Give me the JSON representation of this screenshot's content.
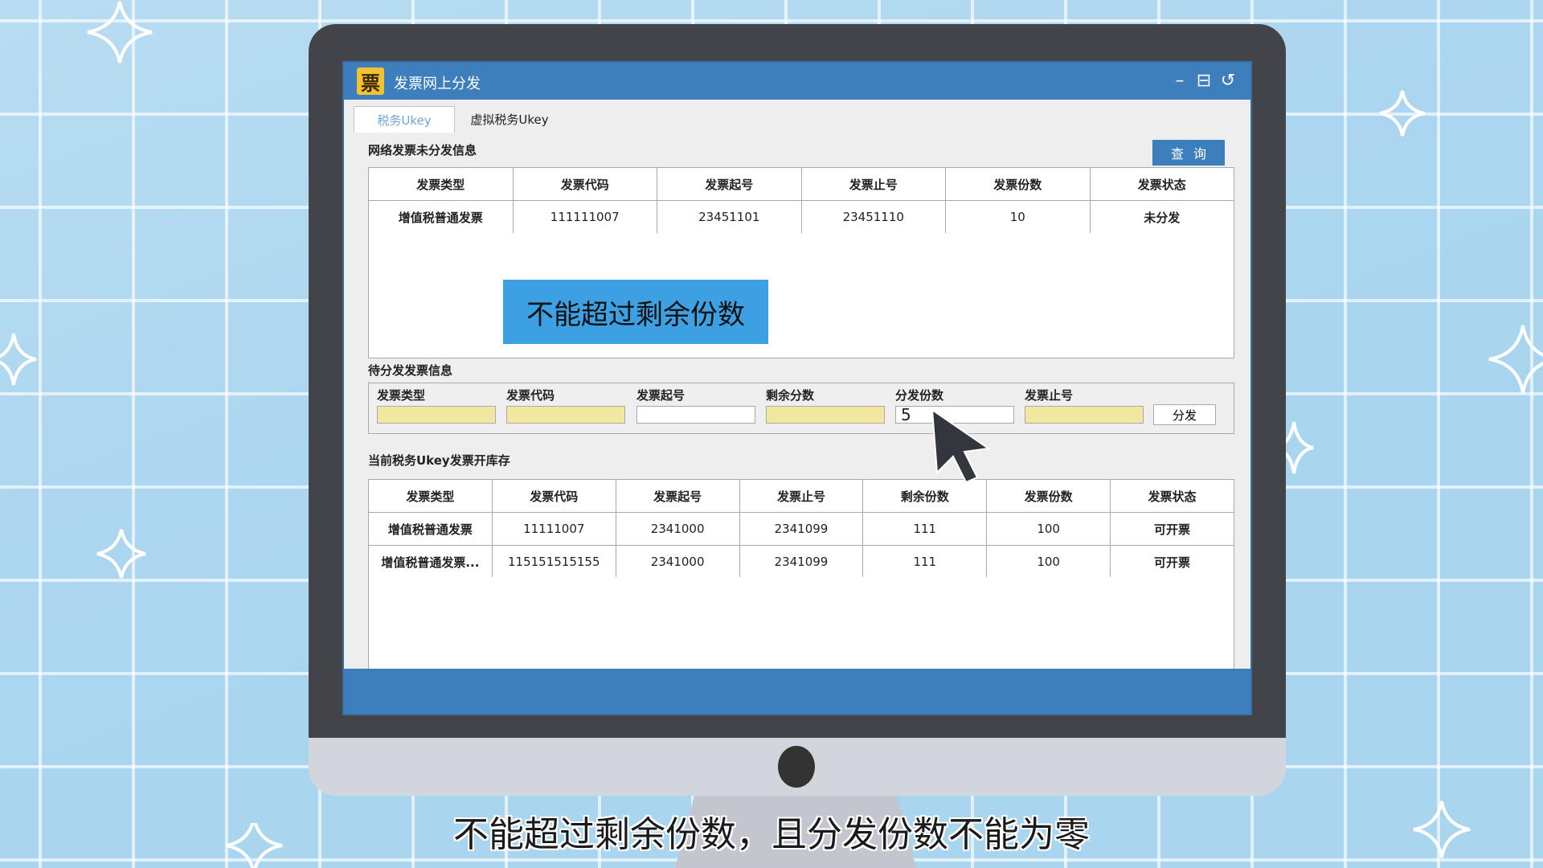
{
  "window": {
    "app_icon_glyph": "票",
    "title": "发票网上分发",
    "controls": {
      "minimize_glyph": "–",
      "restore_glyph": "⊟",
      "back_glyph": "↺"
    }
  },
  "tabs": [
    {
      "label": "税务Ukey",
      "active": true
    },
    {
      "label": "虚拟税务Ukey",
      "active": false
    }
  ],
  "unissued": {
    "section_label": "网络发票未分发信息",
    "query_button": "查询",
    "columns": [
      "发票类型",
      "发票代码",
      "发票起号",
      "发票止号",
      "发票份数",
      "发票状态"
    ],
    "rows": [
      [
        "增值税普通发票",
        "111111007",
        "23451101",
        "23451110",
        "10",
        "未分发"
      ]
    ]
  },
  "callout": {
    "text": "不能超过剩余份数"
  },
  "pending": {
    "section_label": "待分发发票信息",
    "fields": [
      {
        "label": "发票类型",
        "value": ""
      },
      {
        "label": "发票代码",
        "value": ""
      },
      {
        "label": "发票起号",
        "value": ""
      },
      {
        "label": "剩余分数",
        "value": ""
      },
      {
        "label": "分发份数",
        "value": "5"
      },
      {
        "label": "发票止号",
        "value": ""
      }
    ],
    "distribute_button": "分发"
  },
  "inventory": {
    "section_label": "当前税务Ukey发票开库存",
    "columns": [
      "发票类型",
      "发票代码",
      "发票起号",
      "发票止号",
      "剩余份数",
      "发票份数",
      "发票状态"
    ],
    "rows": [
      [
        "增值税普通发票",
        "11111007",
        "2341000",
        "2341099",
        "111",
        "100",
        "可开票"
      ],
      [
        "增值税普通发票...",
        "115151515155",
        "2341000",
        "2341099",
        "111",
        "100",
        "可开票"
      ]
    ]
  },
  "subtitle": "不能超过剩余份数，且分发份数不能为零",
  "colors": {
    "accent_blue": "#3d7fbd",
    "highlight_yellow": "#f3e6a1",
    "callout_blue": "#3da0e3",
    "background_blue": "#a9d5ef"
  },
  "icons": {
    "app_icon": "invoice-icon",
    "cursor": "mouse-pointer-icon"
  }
}
